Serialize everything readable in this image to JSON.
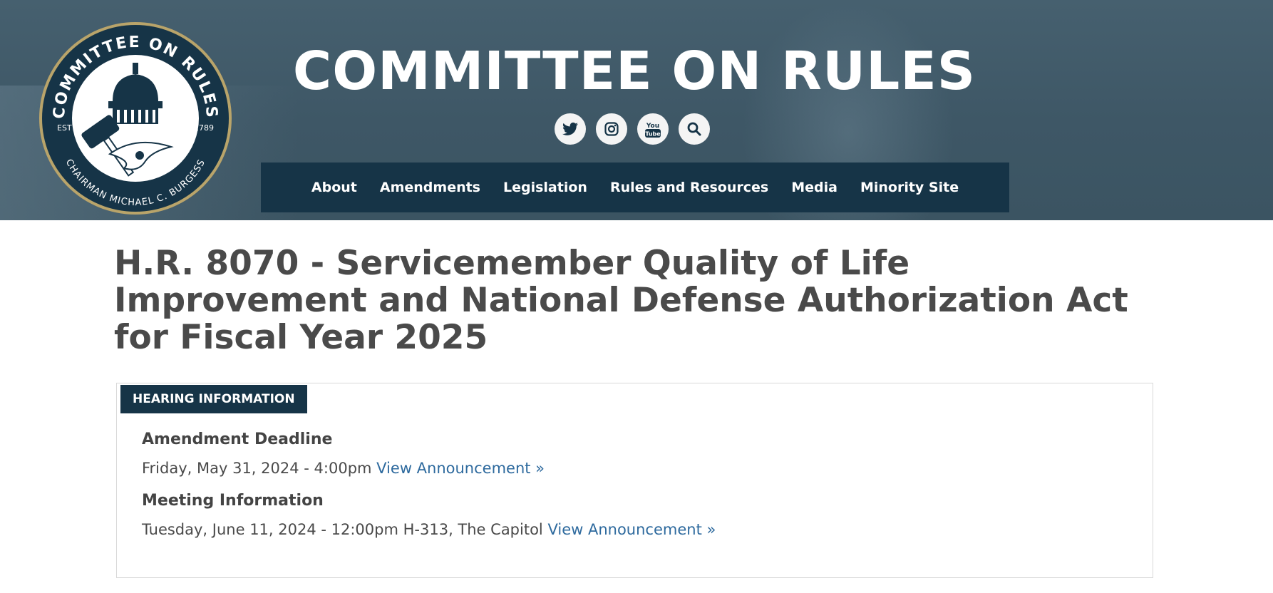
{
  "header": {
    "site_title": "COMMITTEE ON RULES",
    "seal": {
      "top_text": "COMMITTEE ON RULES",
      "bottom_text": "CHAIRMAN MICHAEL C. BURGESS",
      "est_label": "EST",
      "year": "1789"
    },
    "social": [
      {
        "icon": "twitter-icon"
      },
      {
        "icon": "instagram-icon"
      },
      {
        "icon": "youtube-icon",
        "glyph_top": "You",
        "glyph_bottom": "Tube"
      },
      {
        "icon": "search-icon"
      }
    ],
    "nav": [
      "About",
      "Amendments",
      "Legislation",
      "Rules and Resources",
      "Media",
      "Minority Site"
    ]
  },
  "main": {
    "title": "H.R. 8070 - Servicemember Quality of Life Improvement and National Defense Authorization Act for Fiscal Year 2025",
    "hearing_panel": {
      "label": "HEARING INFORMATION",
      "amendment_deadline": {
        "heading": "Amendment Deadline",
        "text": "Friday, May 31, 2024 - 4:00pm ",
        "link": "View Announcement »"
      },
      "meeting_information": {
        "heading": "Meeting Information",
        "text": "Tuesday, June 11, 2024 - 12:00pm H-313, The Capitol ",
        "link": "View Announcement »"
      }
    }
  },
  "colors": {
    "header_bg": "#3e5766",
    "nav_bg": "#163447",
    "link": "#2e6a9e",
    "seal_navy": "#163447",
    "seal_gold": "#b9a46a"
  }
}
